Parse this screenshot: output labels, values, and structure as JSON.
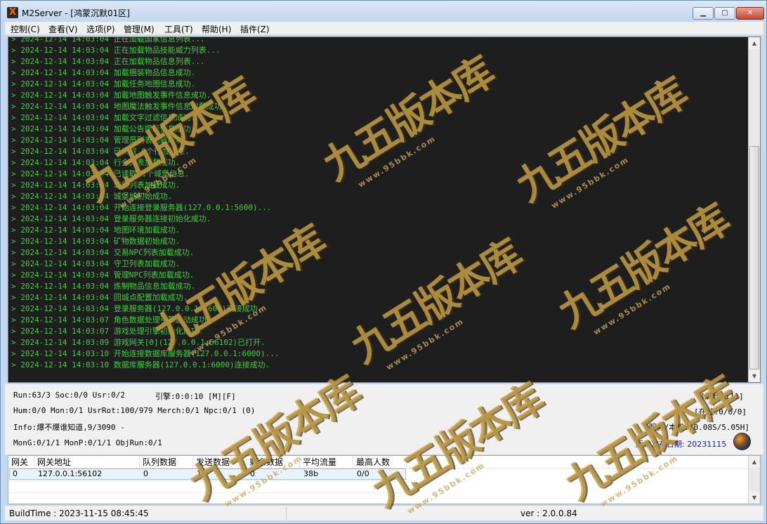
{
  "window": {
    "title": "M2Server - [鸿蒙沉默01区]",
    "icon_glyph": "X",
    "controls": [
      "minimize-icon",
      "maximize-icon",
      "close-icon"
    ]
  },
  "menu": {
    "items": [
      "控制(C)",
      "查看(V)",
      "选项(P)",
      "管理(M)",
      "工具(T)",
      "帮助(H)",
      "插件(Z)"
    ]
  },
  "log": {
    "lines": [
      "> 2024-12-14 14:03:04 正在加载国家信息列表...",
      "> 2024-12-14 14:03:04 正在加载物品技能威力列表...",
      "> 2024-12-14 14:03:04 正在加载物品信息列表...",
      "> 2024-12-14 14:03:04 加载捆装物品信息成功.",
      "> 2024-12-14 14:03:04 加载任务地图信息成功.",
      "> 2024-12-14 14:03:04 加载地图触发事件信息成功.",
      "> 2024-12-14 14:03:04 地图魔法触发事件信息加载成功.",
      "> 2024-12-14 14:03:04 加载文字过滤信息成功.",
      "> 2024-12-14 14:03:04 加载公告提示信息成功.",
      "> 2024-12-14 14:03:04 管理员列表加载成功.",
      "> 2024-12-14 14:03:04 已读取 0个行会信息.",
      "> 2024-12-14 14:03:04 行会列表加载成功.",
      "> 2024-12-14 14:03:04 已读取 1个城堡信息.",
      "> 2024-12-14 14:03:04 城堡列表加载成功.",
      "> 2024-12-14 14:03:04 城堡城初始成功.",
      "> 2024-12-14 14:03:04 开始连接登录服务器(127.0.0.1:5600)...",
      "> 2024-12-14 14:03:04 登录服务器连接初始化成功.",
      "> 2024-12-14 14:03:04 地图环境加载成功.",
      "> 2024-12-14 14:03:04 矿物数据初始成功.",
      "> 2024-12-14 14:03:04 交易NPC列表加载成功.",
      "> 2024-12-14 14:03:04 守卫列表加载成功.",
      "> 2024-12-14 14:03:04 管理NPC列表加载成功.",
      "> 2024-12-14 14:03:04 炼制物品信息加载成功.",
      "> 2024-12-14 14:03:04 回城点配置加载成功.",
      "> 2024-12-14 14:03:04 登录服务器(127.0.0.1:5600)连接成功.",
      "> 2024-12-14 14:03:07 角色数据处理引擎启动成功.",
      "> 2024-12-14 14:03:07 游戏处理引擎初始化成功.",
      "> 2024-12-14 14:03:09 游戏网关[0](127.0.0.1:56102)已打开.",
      "> 2024-12-14 14:03:10 开始连接数据库服务器(127.0.0.1:6000)...",
      "> 2024-12-14 14:03:10 数据库服务器(127.0.0.1:6000)连接成功."
    ]
  },
  "status": {
    "run": "Run:63/3 Soc:0/0 Usr:0/2",
    "engine": "引擎:0:0:10 [M][F]",
    "refresh": "[刷怪:111]",
    "hum": "Hum:0/0 Mon:0/1 UsrRot:100/979 Merch:0/1 Npc:0/1 (0)",
    "online": "[在线:0/0/0]",
    "info": "Info:爆不爆谁知道,9/3090 -",
    "service": "[服务/本机:10.08S/5.05H]",
    "mon": "MonG:0/1/1 MonP:0/1/1 ObjRun:0/1",
    "release": "版本发布日期: 20231115"
  },
  "gateway_table": {
    "columns": [
      "网关",
      "网关地址",
      "队列数据",
      "发送数据",
      "剩余数据",
      "平均流量",
      "最高人数"
    ],
    "rows": [
      [
        "0",
        "127.0.0.1:56102",
        "0",
        "1",
        "0",
        "38b",
        "0/0"
      ]
    ]
  },
  "statusbar": {
    "build_time": "BuildTime : 2023-11-15 08:45:45",
    "version": "ver : 2.0.0.84"
  },
  "watermark": {
    "text": "九五版本库",
    "url": "www.95bbk.com"
  }
}
